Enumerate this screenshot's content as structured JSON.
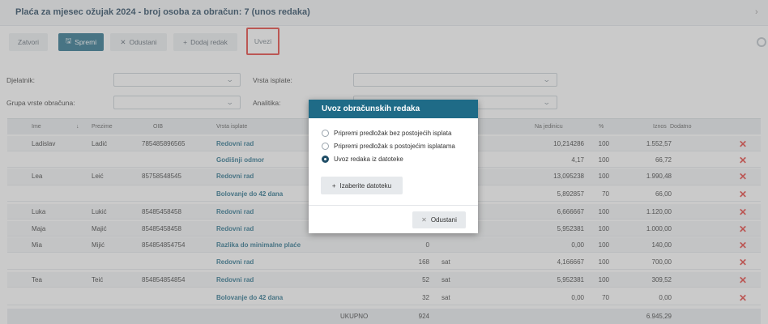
{
  "window": {
    "title": "Plaća za mjesec ožujak 2024 - broj osoba za obračun: 7 (unos redaka)"
  },
  "toolbar": {
    "close_label": "Zatvori",
    "save_label": "Spremi",
    "cancel_label": "Odustani",
    "add_row_label": "Dodaj redak",
    "import_label": "Uvezi"
  },
  "filters": {
    "employee_label": "Djelatnik:",
    "payment_type_label": "Vrsta isplate:",
    "group_label": "Grupa vrste obračuna:",
    "analytics_label": "Analitika:"
  },
  "table": {
    "headers": [
      "Ime",
      "Prezime",
      "OIB",
      "Vrsta isplate",
      "Na jedinicu",
      "%",
      "Iznos",
      "Dodatno"
    ],
    "rows": [
      {
        "ime": "Ladislav",
        "prezime": "Ladić",
        "oib": "785485896565",
        "vrsta": "Redovni rad",
        "kol": "",
        "jed": "",
        "na_jedinicu": "10,214286",
        "pct": "100",
        "iznos": "1.552,57"
      },
      {
        "ime": "",
        "prezime": "",
        "oib": "",
        "vrsta": "Godišnji odmor",
        "kol": "",
        "jed": "",
        "na_jedinicu": "4,17",
        "pct": "100",
        "iznos": "66,72"
      },
      {
        "ime": "Lea",
        "prezime": "Leić",
        "oib": "85758548545",
        "vrsta": "Redovni rad",
        "kol": "",
        "jed": "",
        "na_jedinicu": "13,095238",
        "pct": "100",
        "iznos": "1.990,48"
      },
      {
        "ime": "",
        "prezime": "",
        "oib": "",
        "vrsta": "Bolovanje do 42 dana",
        "kol": "",
        "jed": "",
        "na_jedinicu": "5,892857",
        "pct": "70",
        "iznos": "66,00"
      },
      {
        "ime": "Luka",
        "prezime": "Lukić",
        "oib": "85485458458",
        "vrsta": "Redovni rad",
        "kol": "",
        "jed": "",
        "na_jedinicu": "6,666667",
        "pct": "100",
        "iznos": "1.120,00"
      },
      {
        "ime": "Maja",
        "prezime": "Majić",
        "oib": "85485458458",
        "vrsta": "Redovni rad",
        "kol": "",
        "jed": "",
        "na_jedinicu": "5,952381",
        "pct": "100",
        "iznos": "1.000,00"
      },
      {
        "ime": "Mia",
        "prezime": "Mijić",
        "oib": "854854854754",
        "vrsta": "Razlika do minimalne plaće",
        "kol": "0",
        "jed": "",
        "na_jedinicu": "0,00",
        "pct": "100",
        "iznos": "140,00"
      },
      {
        "ime": "",
        "prezime": "",
        "oib": "",
        "vrsta": "Redovni rad",
        "kol": "168",
        "jed": "sat",
        "na_jedinicu": "4,166667",
        "pct": "100",
        "iznos": "700,00"
      },
      {
        "ime": "Tea",
        "prezime": "Teić",
        "oib": "854854854854",
        "vrsta": "Redovni rad",
        "kol": "52",
        "jed": "sat",
        "na_jedinicu": "5,952381",
        "pct": "100",
        "iznos": "309,52"
      },
      {
        "ime": "",
        "prezime": "",
        "oib": "",
        "vrsta": "Bolovanje do 42 dana",
        "kol": "32",
        "jed": "sat",
        "na_jedinicu": "0,00",
        "pct": "70",
        "iznos": "0,00"
      }
    ],
    "total_label": "UKUPNO",
    "total_qty": "924",
    "total_amount": "6.945,29"
  },
  "modal": {
    "title": "Uvoz obračunskih redaka",
    "options": [
      "Pripremi predložak bez postojećih isplata",
      "Pripremi predložak s postojećim isplatama",
      "Uvoz redaka iz datoteke"
    ],
    "selected_index": 2,
    "file_button_label": "Izaberite datoteku",
    "cancel_label": "Odustani"
  },
  "colors": {
    "accent": "#1f6b87",
    "delete": "#e53935",
    "highlight_border": "#e53935"
  }
}
